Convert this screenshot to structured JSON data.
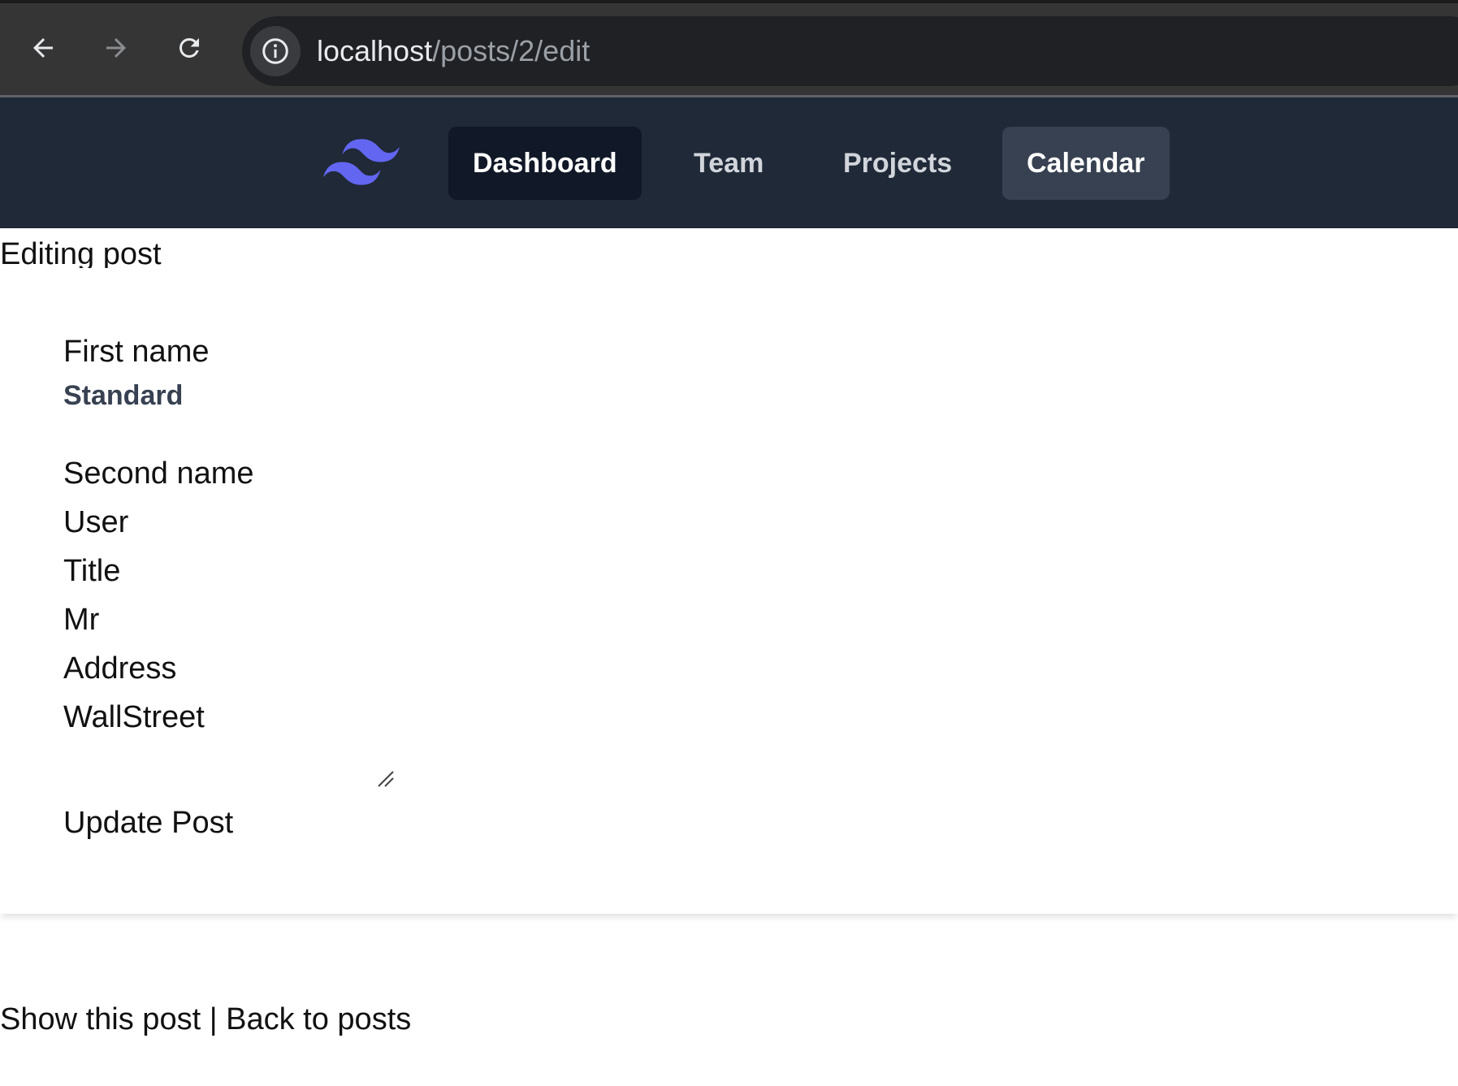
{
  "browser": {
    "url_host": "localhost",
    "url_path": "/posts/2/edit"
  },
  "navbar": {
    "logo_icon": "tailwind-logo-icon",
    "logo_color": "#6366f1",
    "items": [
      {
        "label": "Dashboard"
      },
      {
        "label": "Team"
      },
      {
        "label": "Projects"
      },
      {
        "label": "Calendar"
      }
    ]
  },
  "page": {
    "heading": "Editing post"
  },
  "form": {
    "first_name_label": "First name",
    "first_name_value": "Standard",
    "second_name_label": "Second name",
    "second_name_value": "User",
    "title_label": "Title",
    "title_value": "Mr",
    "address_label": "Address",
    "address_value": "WallStreet",
    "submit_label": "Update Post"
  },
  "footer": {
    "show_link": "Show this post",
    "separator": "|",
    "back_link": "Back to posts"
  }
}
